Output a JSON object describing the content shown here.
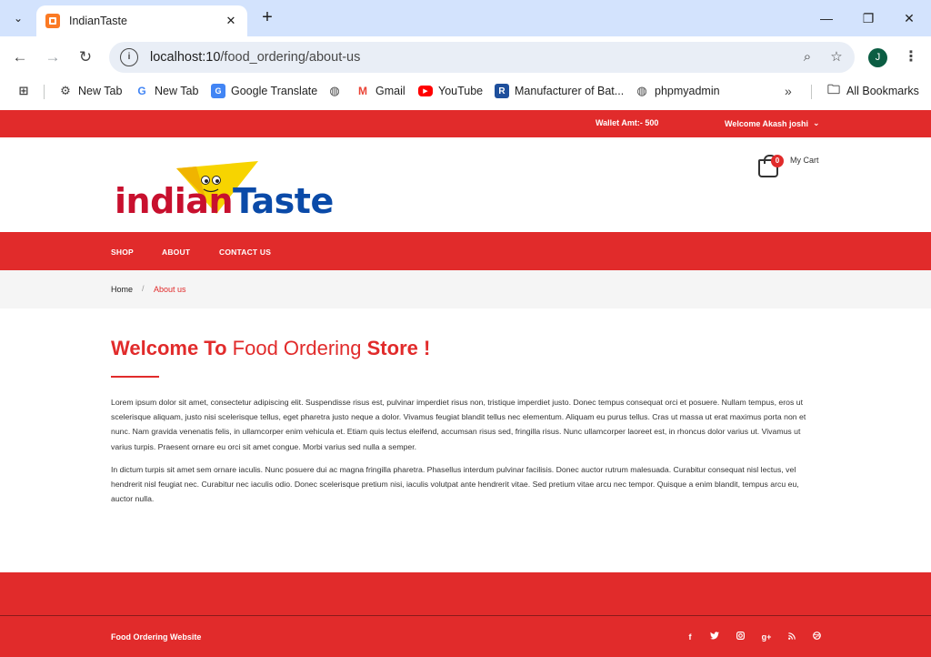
{
  "browser": {
    "tab_title": "IndianTaste",
    "url_host": "localhost:10",
    "url_path": "/food_ordering/about-us",
    "profile_initial": "J",
    "bookmarks": [
      {
        "label": "New Tab",
        "icon": "gear-icon"
      },
      {
        "label": "New Tab",
        "icon": "google-icon"
      },
      {
        "label": "Google Translate",
        "icon": "translate-icon"
      },
      {
        "label": "",
        "icon": "globe-icon"
      },
      {
        "label": "Gmail",
        "icon": "gmail-icon"
      },
      {
        "label": "YouTube",
        "icon": "youtube-icon"
      },
      {
        "label": "Manufacturer of Bat...",
        "icon": "r-icon"
      },
      {
        "label": "phpmyadmin",
        "icon": "globe-icon"
      }
    ],
    "all_bookmarks": "All Bookmarks"
  },
  "topbar": {
    "wallet": "Wallet Amt:- 500",
    "welcome": "Welcome Akash joshi"
  },
  "header": {
    "logo_word1": "indian",
    "logo_word2": "Taste",
    "cart_count": "0",
    "cart_label": "My Cart"
  },
  "nav": {
    "items": [
      "SHOP",
      "ABOUT",
      "CONTACT US"
    ]
  },
  "breadcrumb": {
    "home": "Home",
    "separator": "/",
    "current": "About us"
  },
  "content": {
    "heading_a": "Welcome To ",
    "heading_b": "Food Ordering",
    "heading_c": " Store !",
    "para1": "Lorem ipsum dolor sit amet, consectetur adipiscing elit. Suspendisse risus est, pulvinar imperdiet risus non, tristique imperdiet justo. Donec tempus consequat orci et posuere. Nullam tempus, eros ut scelerisque aliquam, justo nisi scelerisque tellus, eget pharetra justo neque a dolor. Vivamus feugiat blandit tellus nec elementum. Aliquam eu purus tellus. Cras ut massa ut erat maximus porta non et nunc. Nam gravida venenatis felis, in ullamcorper enim vehicula et. Etiam quis lectus eleifend, accumsan risus sed, fringilla risus. Nunc ullamcorper laoreet est, in rhoncus dolor varius ut. Vivamus ut varius turpis. Praesent ornare eu orci sit amet congue. Morbi varius sed nulla a semper.",
    "para2": "In dictum turpis sit amet sem ornare iaculis. Nunc posuere dui ac magna fringilla pharetra. Phasellus interdum pulvinar facilisis. Donec auctor rutrum malesuada. Curabitur consequat nisl lectus, vel hendrerit nisl feugiat nec. Curabitur nec iaculis odio. Donec scelerisque pretium nisi, iaculis volutpat ante hendrerit vitae. Sed pretium vitae arcu nec tempor. Quisque a enim blandit, tempus arcu eu, auctor nulla."
  },
  "footer": {
    "text": "Food Ordering Website",
    "social": [
      "facebook-icon",
      "twitter-icon",
      "instagram-icon",
      "google-plus-icon",
      "rss-icon",
      "dribbble-icon"
    ]
  },
  "colors": {
    "brand_red": "#e12b2b",
    "logo_red": "#c8102e",
    "logo_blue": "#0a4aa8",
    "logo_yellow": "#f7d400"
  }
}
